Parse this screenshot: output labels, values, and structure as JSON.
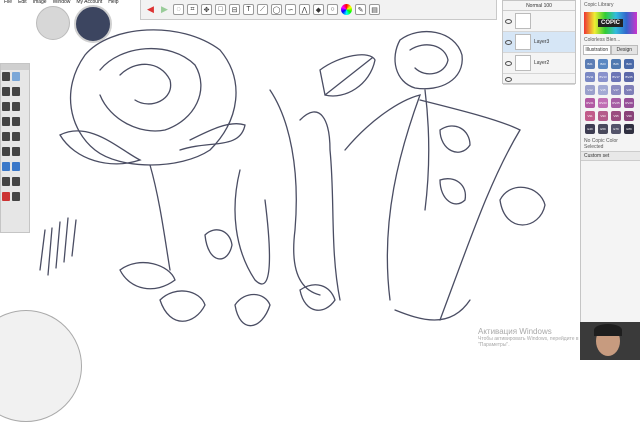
{
  "app": {
    "menu": [
      "File",
      "Edit",
      "Image",
      "Window",
      "My Account",
      "Help"
    ]
  },
  "toolbar": {
    "icons": [
      "undo-icon",
      "redo-icon",
      "lasso-icon",
      "crop-icon",
      "move-icon",
      "transform-icon",
      "symmetry-icon",
      "text-icon",
      "ruler-icon",
      "ellipse-icon",
      "french-curve-icon",
      "perspective-icon",
      "fill-icon",
      "select-icon",
      "color-wheel-icon",
      "brush-icon",
      "layer-icon"
    ]
  },
  "layers": {
    "blend_mode": "Normal",
    "opacity": "100",
    "items": [
      {
        "name": "",
        "active": false
      },
      {
        "name": "Layer3",
        "active": true
      },
      {
        "name": "Layer2",
        "active": false
      },
      {
        "name": "",
        "active": false
      }
    ]
  },
  "copic": {
    "title": "Copic Library",
    "logo": "COPIC",
    "colorless_blender": "Colorless Blen...",
    "tabs": [
      "Illustration",
      "Design"
    ],
    "swatch_colors": [
      "#5b7db5",
      "#5a87c2",
      "#4f79b0",
      "#4a6aa8",
      "#7a88c4",
      "#8a92cc",
      "#6c75b6",
      "#5c68a8",
      "#9aa0cc",
      "#a3aad4",
      "#8c8cc0",
      "#7f7fb8",
      "#b25aa3",
      "#c06eb4",
      "#a55ea4",
      "#964f97",
      "#c25c8a",
      "#b45c8a",
      "#9a4d80",
      "#8a4278",
      "#3e3d52",
      "#4a4a5c",
      "#54546a",
      "#2f2f40"
    ],
    "swatch_codes": [
      "B21",
      "B23",
      "B26",
      "B29",
      "BV11",
      "BV13",
      "BV17",
      "BV25",
      "V12",
      "V15",
      "V17",
      "V25",
      "RV21",
      "RV23",
      "RV25",
      "RV29",
      "V91",
      "V93",
      "V95",
      "V99",
      "E49",
      "E59",
      "E79",
      "E89"
    ],
    "status": "No Copic Color Selected",
    "custom_set": "Custom set"
  },
  "watermark": {
    "line1": "Активация Windows",
    "line2": "Чтобы активировать Windows, перейдите в раздел",
    "line3": "\"Параметры\"."
  }
}
